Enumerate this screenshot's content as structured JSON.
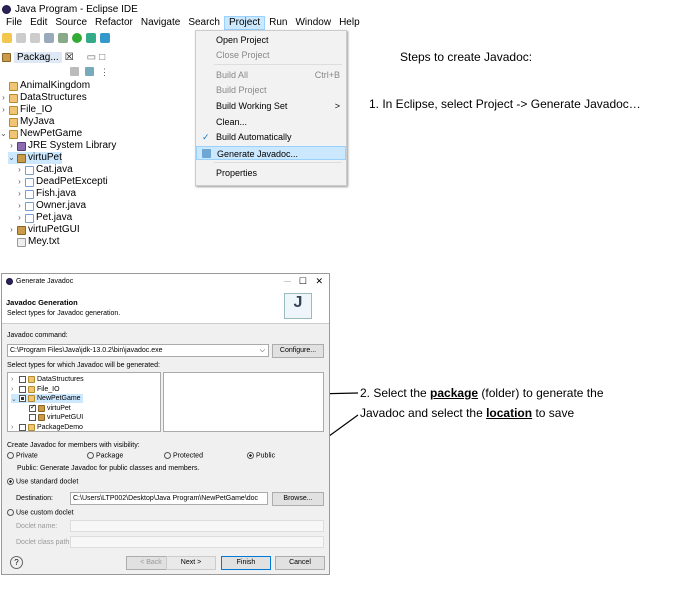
{
  "window_title": "Java Program - Eclipse IDE",
  "menubar": [
    "File",
    "Edit",
    "Source",
    "Refactor",
    "Navigate",
    "Search",
    "Project",
    "Run",
    "Window",
    "Help"
  ],
  "package_explorer": {
    "tab_label": "Packag...",
    "close": "☒",
    "items": [
      {
        "label": "AnimalKingdom",
        "indent": 0,
        "icon": "project"
      },
      {
        "label": "DataStructures",
        "indent": 0,
        "icon": "project",
        "twisty": ">"
      },
      {
        "label": "File_IO",
        "indent": 0,
        "icon": "project",
        "twisty": ">"
      },
      {
        "label": "MyJava",
        "indent": 0,
        "icon": "project"
      },
      {
        "label": "NewPetGame",
        "indent": 0,
        "icon": "project",
        "twisty": "v"
      },
      {
        "label": "JRE System Library",
        "indent": 1,
        "icon": "library",
        "twisty": ">"
      },
      {
        "label": "virtuPet",
        "indent": 1,
        "icon": "package",
        "twisty": "v",
        "selected": true
      },
      {
        "label": "Cat.java",
        "indent": 2,
        "icon": "java",
        "twisty": ">"
      },
      {
        "label": "DeadPetExcepti",
        "indent": 2,
        "icon": "java",
        "twisty": ">"
      },
      {
        "label": "Fish.java",
        "indent": 2,
        "icon": "java",
        "twisty": ">"
      },
      {
        "label": "Owner.java",
        "indent": 2,
        "icon": "java",
        "twisty": ">"
      },
      {
        "label": "Pet.java",
        "indent": 2,
        "icon": "java",
        "twisty": ">"
      },
      {
        "label": "virtuPetGUI",
        "indent": 1,
        "icon": "package",
        "twisty": ">"
      },
      {
        "label": "Mey.txt",
        "indent": 1,
        "icon": "file"
      }
    ]
  },
  "project_menu": {
    "items": [
      {
        "label": "Open Project",
        "enabled": true
      },
      {
        "label": "Close Project",
        "enabled": false
      },
      {
        "label": "Build All",
        "enabled": false,
        "shortcut": "Ctrl+B"
      },
      {
        "label": "Build Project",
        "enabled": false
      },
      {
        "label": "Build Working Set",
        "enabled": true,
        "submenu": ">"
      },
      {
        "label": "Clean...",
        "enabled": true
      },
      {
        "label": "Build Automatically",
        "enabled": true,
        "checked": true
      },
      {
        "label": "Generate Javadoc...",
        "enabled": true,
        "highlighted": true
      },
      {
        "label": "Properties",
        "enabled": true
      }
    ]
  },
  "steps": {
    "heading": "Steps to create Javadoc:",
    "step1": "1. In Eclipse, select Project -> Generate Javadoc…",
    "step2_prefix": "2.  Select the ",
    "step2_package": "package",
    "step2_mid": " (folder) to generate the",
    "step2_line2_prefix": "Javadoc and select the ",
    "step2_location": "location",
    "step2_suffix": " to save"
  },
  "dialog": {
    "title": "Generate Javadoc",
    "heading": "Javadoc Generation",
    "subheading": "Select types for Javadoc generation.",
    "command_label": "Javadoc command:",
    "command_value": "C:\\Program Files\\Java\\jdk-13.0.2\\bin\\javadoc.exe",
    "configure": "Configure...",
    "types_label": "Select types for which Javadoc will be generated:",
    "types_tree": [
      {
        "label": "DataStructures",
        "indent": 0,
        "state": "off"
      },
      {
        "label": "File_IO",
        "indent": 0,
        "state": "off"
      },
      {
        "label": "NewPetGame",
        "indent": 0,
        "state": "partial",
        "selected": true
      },
      {
        "label": "virtuPet",
        "indent": 1,
        "state": "on"
      },
      {
        "label": "virtuPetGUI",
        "indent": 1,
        "state": "off"
      },
      {
        "label": "PackageDemo",
        "indent": 0,
        "state": "off"
      }
    ],
    "visibility_label": "Create Javadoc for members with visibility:",
    "visibility_options": [
      "Private",
      "Package",
      "Protected",
      "Public"
    ],
    "visibility_selected": "Public",
    "visibility_desc": "Public: Generate Javadoc for public classes and members.",
    "standard_doclet": "Use standard doclet",
    "destination_label": "Destination:",
    "destination_value": "C:\\Users\\LTP002\\Desktop\\Java Program\\NewPetGame\\doc",
    "browse": "Browse...",
    "custom_doclet": "Use custom doclet",
    "doclet_name": "Doclet name:",
    "doclet_class_path": "Doclet class path:",
    "help": "?",
    "back": "< Back",
    "next": "Next >",
    "finish": "Finish",
    "cancel": "Cancel"
  }
}
